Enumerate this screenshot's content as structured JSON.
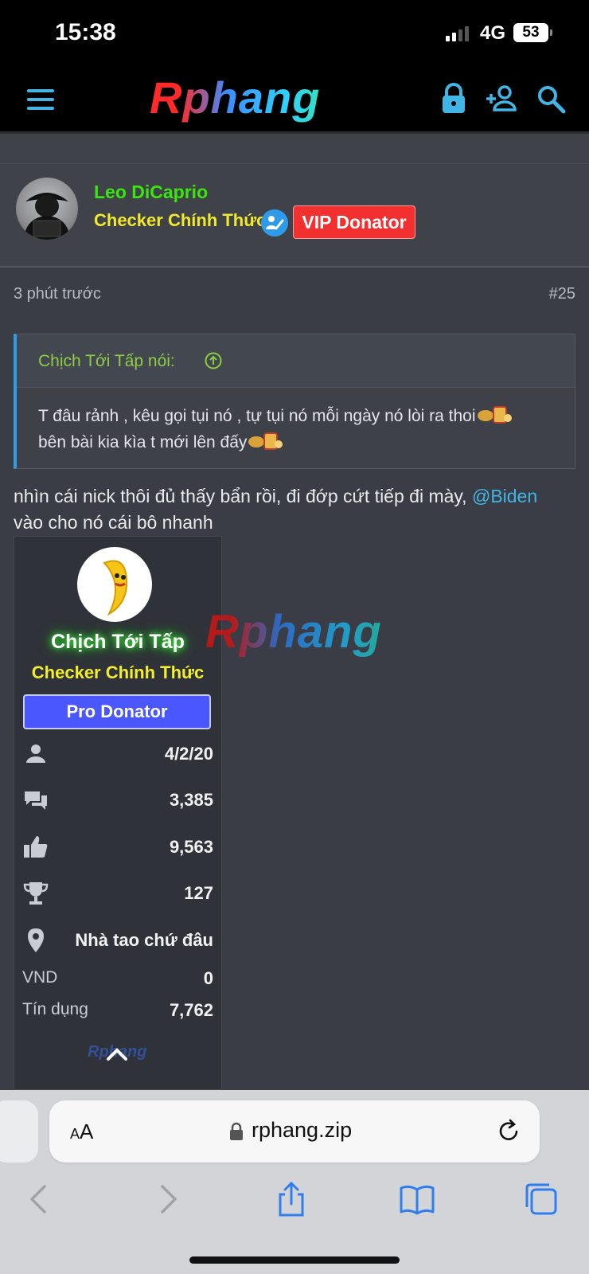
{
  "status_bar": {
    "time": "15:38",
    "network": "4G",
    "battery": "53"
  },
  "site": {
    "logo": "Rphang"
  },
  "post": {
    "author": {
      "name": "Leo DiCaprio",
      "title": "Checker Chính Thức",
      "badge": "VIP Donator"
    },
    "time": "3 phút trước",
    "number": "#25",
    "quote": {
      "author": "Chịch Tới Tấp nói:",
      "line1": "T đâu rảnh , kêu gọi tụi nó , tự tụi nó mỗi ngày nó lòi ra thoi",
      "line2": "bên bài kia kìa t mới lên đấy"
    },
    "text_before": "nhìn cái nick thôi đủ thấy bẩn rồi, đi đớp cứt tiếp đi mày, ",
    "mention": "@Biden",
    "text_after": "vào cho nó cái bô nhanh"
  },
  "signature": {
    "name": "Chịch Tới Tấp",
    "title": "Checker Chính Thức",
    "badge": "Pro Donator",
    "joined": "4/2/20",
    "messages": "3,385",
    "reactions": "9,563",
    "points": "127",
    "location": "Nhà tao chứ đâu",
    "vnd_label": "VND",
    "vnd_value": "0",
    "credit_label": "Tín dụng",
    "credit_value": "7,762",
    "watermark": "Rphang"
  },
  "watermark": "Rphang",
  "browser": {
    "aa_small": "A",
    "aa_big": "A",
    "url": "rphang.zip"
  },
  "colors": {
    "accent": "#41b6e6",
    "username": "#39e60d",
    "title": "#f0e92c",
    "vip": "#f23030",
    "pro": "#4a57ff"
  }
}
